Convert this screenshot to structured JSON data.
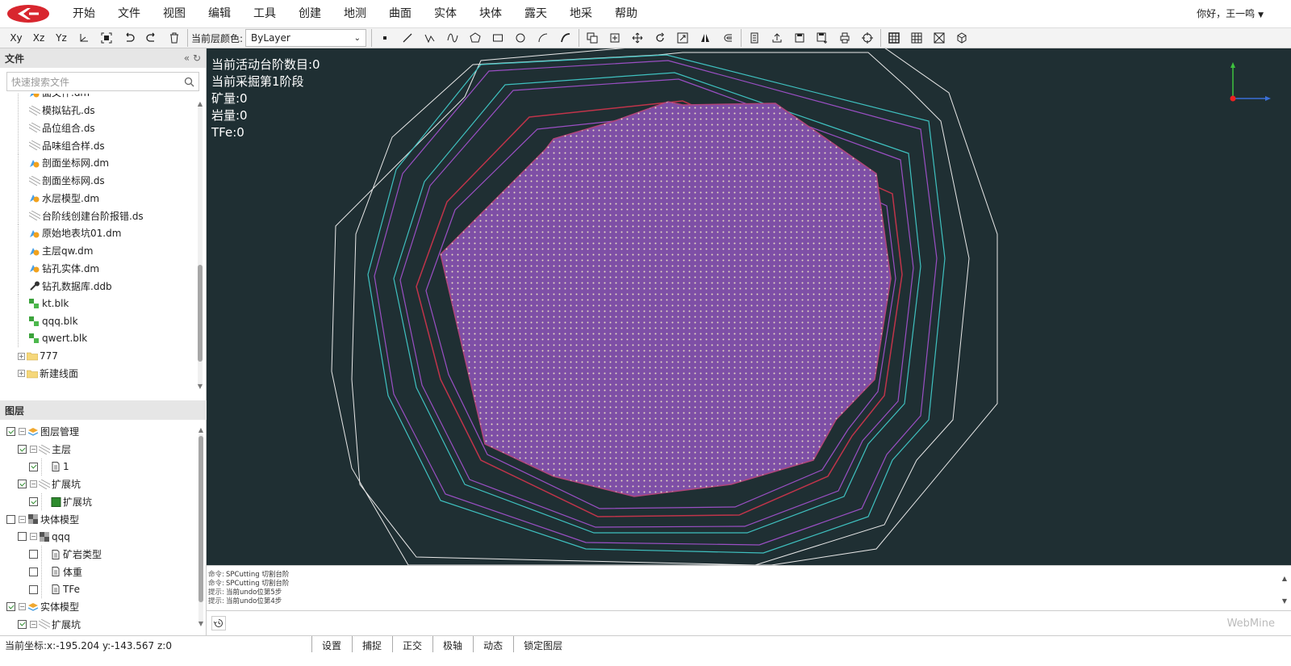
{
  "menubar": {
    "items": [
      "开始",
      "文件",
      "视图",
      "编辑",
      "工具",
      "创建",
      "地测",
      "曲面",
      "实体",
      "块体",
      "露天",
      "地采",
      "帮助"
    ],
    "user": "你好，王一鸣"
  },
  "toolbar": {
    "axis_buttons": [
      "Xy",
      "Xz",
      "Yz"
    ],
    "layer_color_label": "当前层颜色:",
    "layer_color_value": "ByLayer"
  },
  "files_panel": {
    "title": "文件",
    "search_placeholder": "快速搜索文件",
    "items": [
      {
        "name": "面文件.dm",
        "type": "dm"
      },
      {
        "name": "模拟钻孔.ds",
        "type": "ds"
      },
      {
        "name": "品位组合.ds",
        "type": "ds"
      },
      {
        "name": "品味组合样.ds",
        "type": "ds"
      },
      {
        "name": "剖面坐标网.dm",
        "type": "dm"
      },
      {
        "name": "剖面坐标网.ds",
        "type": "ds"
      },
      {
        "name": "水层模型.dm",
        "type": "dm"
      },
      {
        "name": "台阶线创建台阶报错.ds",
        "type": "ds"
      },
      {
        "name": "原始地表坑01.dm",
        "type": "dm"
      },
      {
        "name": "主层qw.dm",
        "type": "dm"
      },
      {
        "name": "钻孔实体.dm",
        "type": "dm"
      },
      {
        "name": "钻孔数据库.ddb",
        "type": "ddb"
      },
      {
        "name": "kt.blk",
        "type": "blk"
      },
      {
        "name": "qqq.blk",
        "type": "blk"
      },
      {
        "name": "qwert.blk",
        "type": "blk"
      },
      {
        "name": "777",
        "type": "folder"
      },
      {
        "name": "新建线面",
        "type": "folder"
      }
    ]
  },
  "layers_panel": {
    "title": "图层",
    "items": [
      {
        "label": "图层管理",
        "checked": true,
        "indent": 0,
        "icon": "layers"
      },
      {
        "label": "主层",
        "checked": true,
        "indent": 1,
        "icon": "lines"
      },
      {
        "label": "1",
        "checked": true,
        "indent": 2,
        "icon": "doc"
      },
      {
        "label": "扩展坑",
        "checked": true,
        "indent": 1,
        "icon": "lines"
      },
      {
        "label": "扩展坑",
        "checked": true,
        "indent": 2,
        "icon": "green-square"
      },
      {
        "label": "块体模型",
        "checked": false,
        "indent": 0,
        "icon": "block"
      },
      {
        "label": "qqq",
        "checked": false,
        "indent": 1,
        "icon": "block"
      },
      {
        "label": "矿岩类型",
        "checked": false,
        "indent": 2,
        "icon": "doc"
      },
      {
        "label": "体重",
        "checked": false,
        "indent": 2,
        "icon": "doc"
      },
      {
        "label": "TFe",
        "checked": false,
        "indent": 2,
        "icon": "doc"
      },
      {
        "label": "实体模型",
        "checked": true,
        "indent": 0,
        "icon": "layers"
      },
      {
        "label": "扩展坑",
        "checked": true,
        "indent": 1,
        "icon": "lines"
      }
    ]
  },
  "viewport": {
    "info": [
      "当前活动台阶数目:0",
      "当前采掘第1阶段",
      "矿量:0",
      "岩量:0",
      "TFe:0"
    ]
  },
  "console": {
    "lines": [
      {
        "k": "命令:",
        "v": "SPCutting 切割台阶"
      },
      {
        "k": "命令:",
        "v": "SPCutting 切割台阶"
      },
      {
        "k": "提示:",
        "v": "当前undo位第5步"
      },
      {
        "k": "提示:",
        "v": "当前undo位第4步"
      }
    ],
    "brand": "WebMine"
  },
  "statusbar": {
    "coords": "当前坐标:x:-195.204   y:-143.567   z:0",
    "buttons": [
      "设置",
      "捕捉",
      "正交",
      "极轴",
      "动态",
      "锁定图层"
    ]
  },
  "colors": {
    "viewport_bg": "#1f2f33",
    "pit_fill": "#7e4fa6",
    "white_line": "#e8e8e8",
    "cyan_line": "#3fc1c0",
    "red_line": "#c0344a",
    "purple_line": "#9a4fc4"
  }
}
